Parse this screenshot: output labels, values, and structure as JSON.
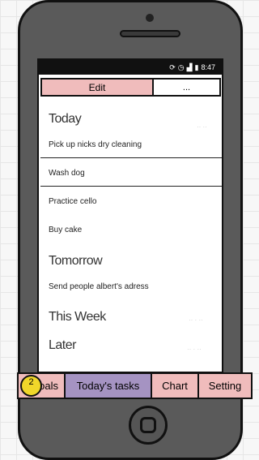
{
  "status_bar": {
    "icons": [
      "sync-icon",
      "alarm-icon",
      "signal-icon",
      "battery-icon"
    ],
    "time": "8:47"
  },
  "top_tabs": {
    "edit_label": "Edit",
    "more_label": "..."
  },
  "sections": {
    "today": "Today",
    "tomorrow": "Tomorrow",
    "this_week": "This Week",
    "later": "Later"
  },
  "tasks": {
    "today": [
      "Pick up nicks dry cleaning",
      "Wash dog",
      "Practice cello",
      "Buy cake"
    ],
    "tomorrow": [
      "Send people albert's adress"
    ]
  },
  "bottom_nav": {
    "goals": "Goals",
    "goals_badge": "2",
    "today": "Today's tasks",
    "chart": "Chart",
    "setting": "Setting"
  },
  "colors": {
    "tab_inactive": "#f0bcbc",
    "tab_active": "#a593c2",
    "badge": "#f1d72a",
    "device": "#5a5a5a"
  }
}
